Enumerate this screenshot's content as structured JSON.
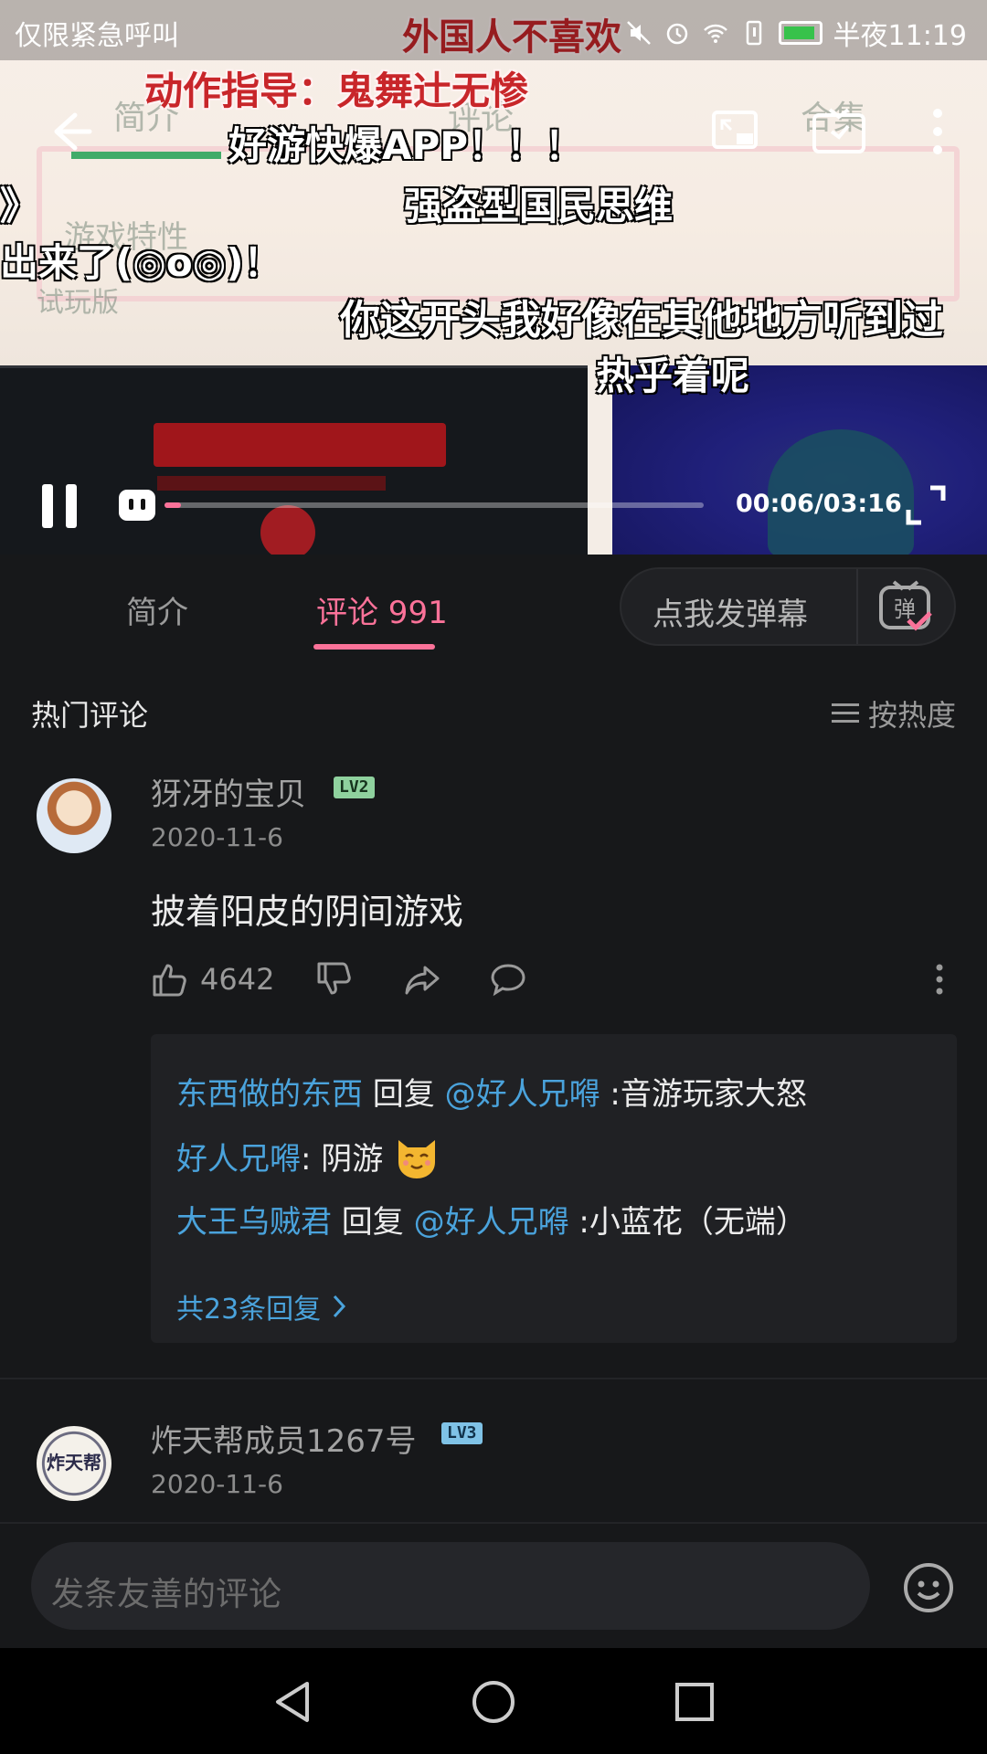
{
  "status_bar": {
    "carrier_text": "仅限紧急呼叫",
    "time": "半夜11:19"
  },
  "player": {
    "time_display": "00:06/03:16",
    "progress": 0.03,
    "ghost_tabs": [
      "简介",
      "评论",
      "合集"
    ],
    "ghost_section": "游戏特性",
    "ghost_subtitle": "试玩版",
    "danmaku": [
      {
        "text": "动作指导：鬼舞辻无惨",
        "color": "red"
      },
      {
        "text": "好游快爆APP！！！",
        "color": "white"
      },
      {
        "text": "强盗型国民思维",
        "color": "white"
      },
      {
        "text": "你这开头我好像在其他地方听到过",
        "color": "white"
      },
      {
        "text": "热乎着呢",
        "color": "white"
      },
      {
        "text": "出来了(◎o◎)！",
        "color": "white"
      },
      {
        "text": "外国人不喜欢",
        "color": "red"
      },
      {
        "text": "》",
        "color": "white"
      }
    ]
  },
  "tabs": {
    "intro": "简介",
    "comments": "评论 991"
  },
  "send_danmaku": {
    "label": "点我发弹幕",
    "icon_glyph": "弹"
  },
  "comments_section": {
    "header": "热门评论",
    "sort_label": "按热度"
  },
  "comments": [
    {
      "username": "犽冴的宝贝",
      "level": "LV2",
      "date": "2020-11-6",
      "text": "披着阳皮的阴间游戏",
      "likes": "4642",
      "replies": [
        {
          "user": "东西做的东西",
          "verb": " 回复 ",
          "mention": "@好人兄嘚",
          "text": " :音游玩家大怒"
        },
        {
          "user": "好人兄嘚",
          "text": ": 阴游 "
        },
        {
          "user": "大王乌贼君",
          "verb": " 回复 ",
          "mention": "@好人兄嘚",
          "text": " :小蓝花（无端）"
        }
      ],
      "more_replies": "共23条回复"
    },
    {
      "username": "炸天帮成员1267号",
      "level": "LV3",
      "date": "2020-11-6",
      "avatar_text": "炸天帮"
    }
  ],
  "input": {
    "placeholder": "发条友善的评论"
  },
  "colors": {
    "accent": "#fb7299",
    "link": "#4aa3dc",
    "background": "#17181a"
  }
}
